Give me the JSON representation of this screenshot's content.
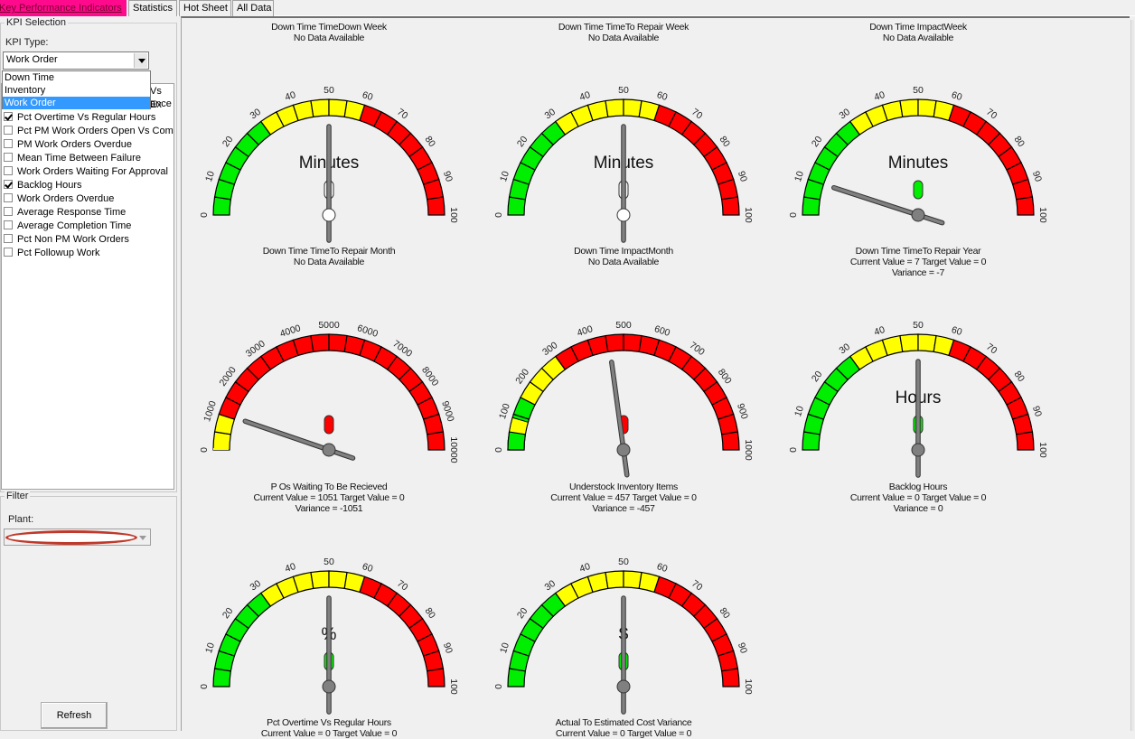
{
  "tabs": [
    {
      "label": "Key Performance Indicators",
      "active": true
    },
    {
      "label": "Statistics",
      "active": false
    },
    {
      "label": "Hot Sheet",
      "active": false
    },
    {
      "label": "All Data",
      "active": false
    }
  ],
  "kpi_selection": {
    "group_label": "KPI Selection",
    "kpi_type_label": "KPI Type:",
    "kpi_type_value": "Work Order",
    "dropdown_options": [
      {
        "label": "Down Time",
        "selected": false
      },
      {
        "label": "Inventory",
        "selected": false
      },
      {
        "label": "Work Order",
        "selected": true
      }
    ],
    "obscured_items": [
      "Vs Ex",
      "ance"
    ],
    "items": [
      {
        "label": "Pct Overtime Vs Regular Hours",
        "checked": true
      },
      {
        "label": "Pct PM Work Orders Open Vs Com",
        "checked": false
      },
      {
        "label": "PM Work Orders Overdue",
        "checked": false
      },
      {
        "label": "Mean Time Between Failure",
        "checked": false
      },
      {
        "label": "Work Orders Waiting For Approval",
        "checked": false
      },
      {
        "label": "Backlog Hours",
        "checked": true
      },
      {
        "label": "Work Orders Overdue",
        "checked": false
      },
      {
        "label": "Average Response Time",
        "checked": false
      },
      {
        "label": "Average Completion Time",
        "checked": false
      },
      {
        "label": "Pct Non PM Work Orders",
        "checked": false
      },
      {
        "label": "Pct Followup Work",
        "checked": false
      }
    ]
  },
  "filter": {
    "group_label": "Filter",
    "plant_label": "Plant:",
    "plant_value": ""
  },
  "refresh_label": "Refresh",
  "colors": {
    "green": "#00ee00",
    "yellow": "#ffff00",
    "red": "#ff0000",
    "needle": "#808080",
    "active_tab": "#ff0a8c",
    "selection": "#3399ff"
  },
  "gauges": [
    {
      "title": "Down Time TimeDown Week",
      "lines": [
        "No Data Available"
      ],
      "unit": "Minutes",
      "max": 100,
      "green_to": 30,
      "yellow_to": 60,
      "needle_value": 50,
      "indicator": "empty",
      "pivot": "white"
    },
    {
      "title": "Down Time TimeTo Repair Week",
      "lines": [
        "No Data Available"
      ],
      "unit": "Minutes",
      "max": 100,
      "green_to": 30,
      "yellow_to": 60,
      "needle_value": 50,
      "indicator": "empty",
      "pivot": "white"
    },
    {
      "title": "Down Time ImpactWeek",
      "lines": [
        "No Data Available"
      ],
      "unit": "Minutes",
      "max": 100,
      "green_to": 30,
      "yellow_to": 60,
      "needle_value": 10,
      "indicator": "green",
      "pivot": "gray"
    },
    {
      "title": "Down Time TimeTo Repair Month",
      "lines": [
        "No Data Available"
      ],
      "unit": "",
      "max": 10000,
      "green_to": 0,
      "yellow_to": 10,
      "needle_value": 1051,
      "indicator": "red",
      "pivot": "gray"
    },
    {
      "title": "Down Time ImpactMonth",
      "lines": [
        "No Data Available"
      ],
      "unit": "",
      "max": 1000,
      "green_to": 15,
      "yellow_to": 30,
      "needle_value": 457,
      "indicator": "red",
      "pivot": "gray"
    },
    {
      "title": "Down Time TimeTo Repair Year",
      "lines": [
        "Current Value = 7  Target Value = 0",
        "Variance = -7"
      ],
      "unit": "Hours",
      "max": 100,
      "green_to": 30,
      "yellow_to": 60,
      "needle_value": 50,
      "indicator": "green",
      "pivot": "gray"
    },
    {
      "title": "P Os Waiting To Be Recieved",
      "lines": [
        "Current Value = 1051  Target Value = 0",
        "Variance = -1051"
      ],
      "unit": "%",
      "max": 100,
      "green_to": 30,
      "yellow_to": 60,
      "needle_value": 50,
      "indicator": "green",
      "pivot": "gray"
    },
    {
      "title": "Understock Inventory Items",
      "lines": [
        "Current Value = 457  Target Value = 0",
        "Variance = -457"
      ],
      "unit": "$",
      "max": 100,
      "green_to": 30,
      "yellow_to": 60,
      "needle_value": 50,
      "indicator": "green",
      "pivot": "gray"
    },
    {
      "title": "Backlog Hours",
      "lines": [
        "Current Value = 0  Target Value = 0",
        "Variance = 0"
      ],
      "unit": null,
      "max": null
    },
    {
      "title": "Pct Overtime Vs Regular Hours",
      "lines": [
        "Current Value = 0  Target Value = 0"
      ],
      "unit": null,
      "max": null
    },
    {
      "title": "Actual To Estimated Cost Variance",
      "lines": [
        "Current Value = 0  Target Value = 0"
      ],
      "unit": null,
      "max": null
    }
  ]
}
